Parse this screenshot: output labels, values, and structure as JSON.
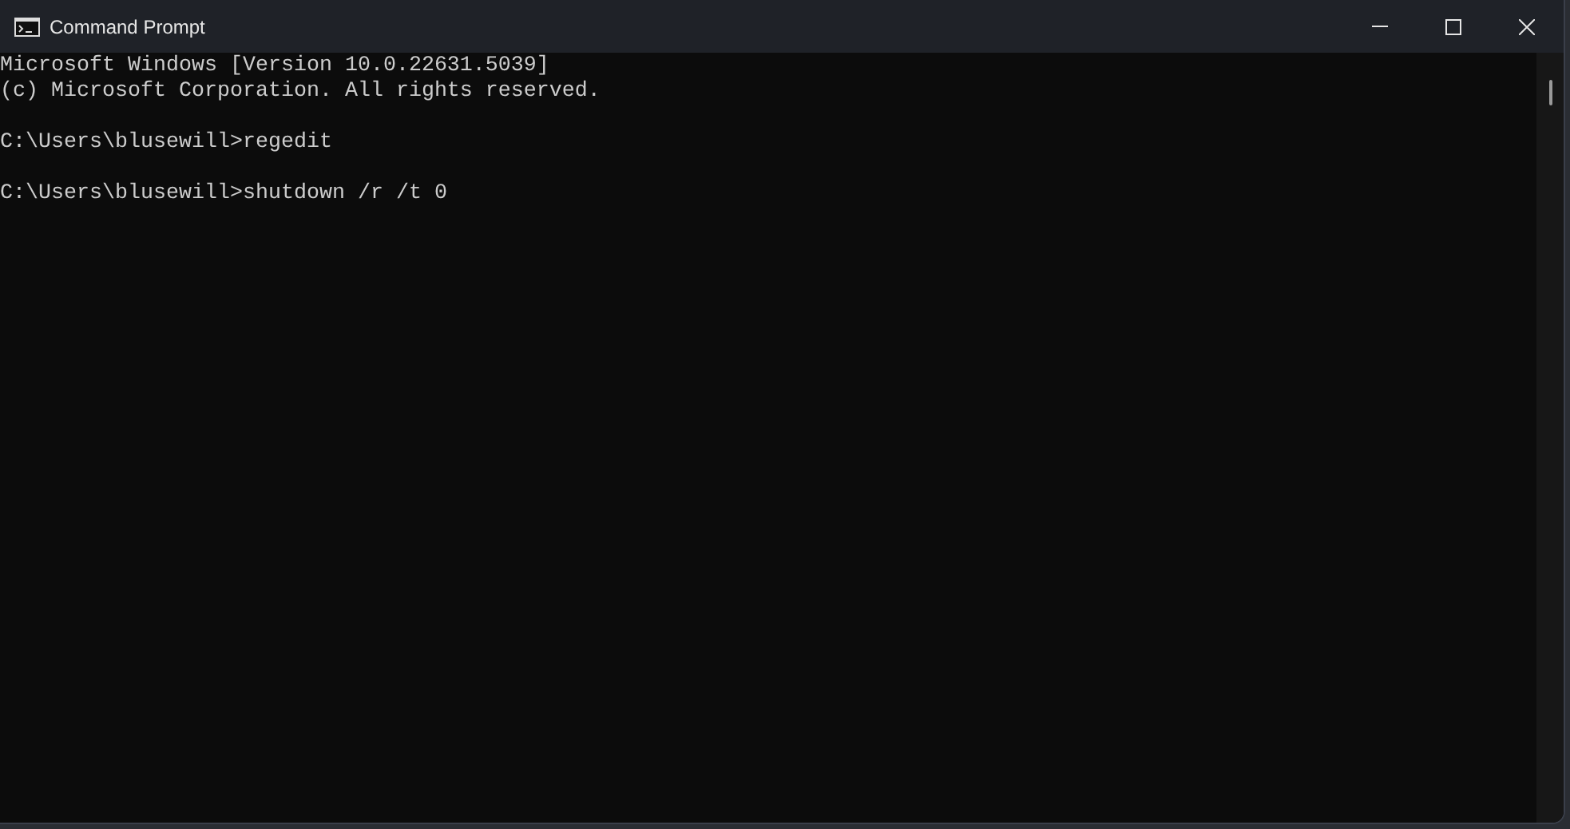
{
  "window": {
    "title": "Command Prompt"
  },
  "console": {
    "blocks": [
      [
        "Microsoft Windows [Version 10.0.22631.5039]",
        "(c) Microsoft Corporation. All rights reserved."
      ],
      [
        "C:\\Users\\blusewill>regedit"
      ],
      [
        "C:\\Users\\blusewill>shutdown /r /t 0"
      ]
    ]
  }
}
